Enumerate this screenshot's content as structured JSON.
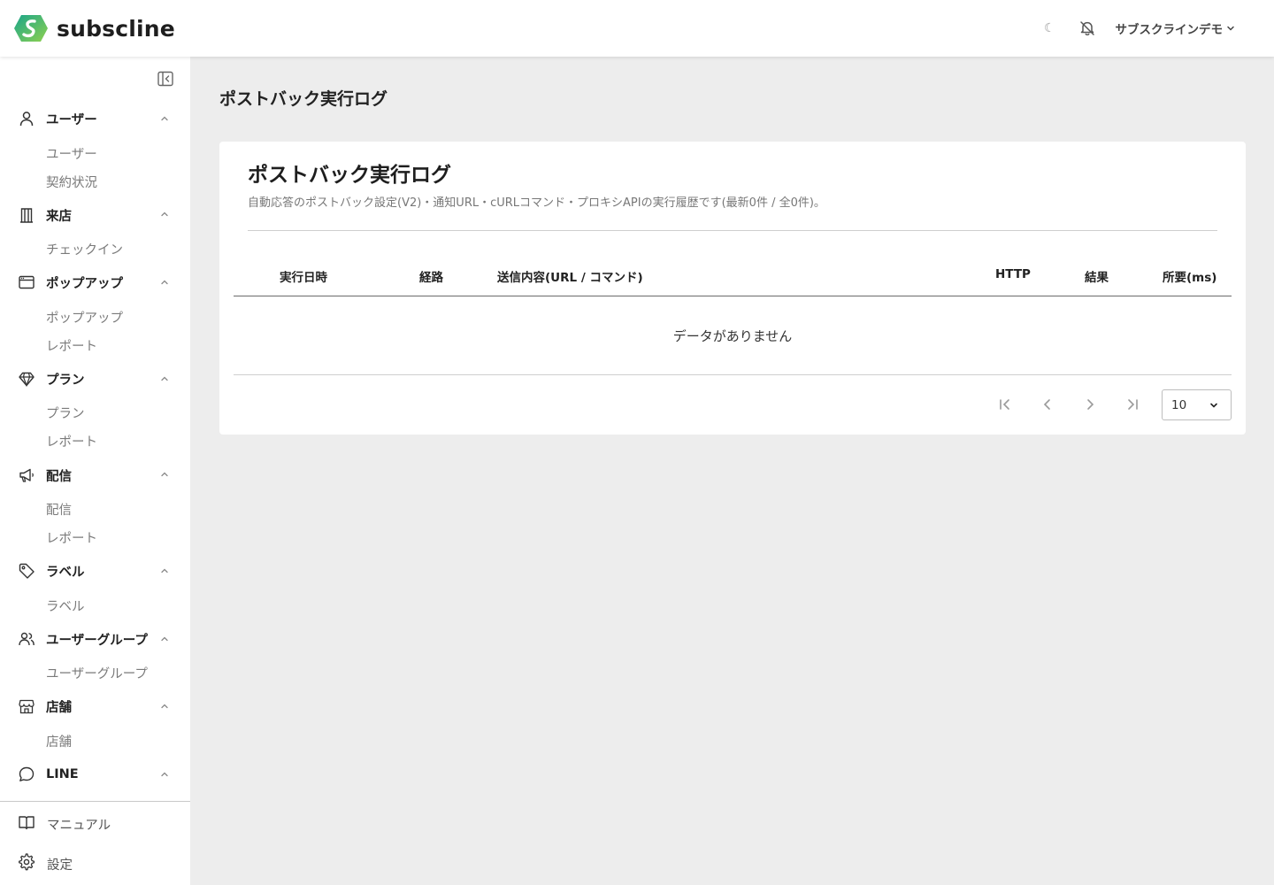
{
  "header": {
    "logo_text": "subscline",
    "theme_icon": "moon-icon",
    "notification_icon": "bell-off-icon",
    "account_name": "サブスクラインデモ"
  },
  "sidebar": {
    "groups": [
      {
        "label": "ユーザー",
        "icon": "user-icon",
        "items": [
          "ユーザー",
          "契約状況"
        ]
      },
      {
        "label": "来店",
        "icon": "building-icon",
        "items": [
          "チェックイン"
        ]
      },
      {
        "label": "ポップアップ",
        "icon": "browser-window-icon",
        "items": [
          "ポップアップ",
          "レポート"
        ]
      },
      {
        "label": "プラン",
        "icon": "diamond-icon",
        "items": [
          "プラン",
          "レポート"
        ]
      },
      {
        "label": "配信",
        "icon": "megaphone-icon",
        "items": [
          "配信",
          "レポート"
        ]
      },
      {
        "label": "ラベル",
        "icon": "tag-icon",
        "items": [
          "ラベル"
        ]
      },
      {
        "label": "ユーザーグループ",
        "icon": "users-icon",
        "items": [
          "ユーザーグループ"
        ]
      },
      {
        "label": "店舗",
        "icon": "store-icon",
        "items": [
          "店舗"
        ]
      },
      {
        "label": "LINE",
        "icon": "chat-bubble-icon",
        "items": []
      }
    ],
    "footer": [
      {
        "label": "マニュアル",
        "icon": "book-icon"
      },
      {
        "label": "設定",
        "icon": "gear-icon"
      }
    ]
  },
  "main": {
    "page_title": "ポストバック実行ログ",
    "card": {
      "title": "ポストバック実行ログ",
      "description": "自動応答のポストバック設定(V2)・通知URL・cURLコマンド・プロキシAPIの実行履歴です(最新0件 / 全0件)。",
      "columns": [
        "実行日時",
        "経路",
        "送信内容(URL / コマンド)",
        "HTTP",
        "結果",
        "所要(ms)"
      ],
      "empty_text": "データがありません",
      "page_size": "10"
    }
  }
}
